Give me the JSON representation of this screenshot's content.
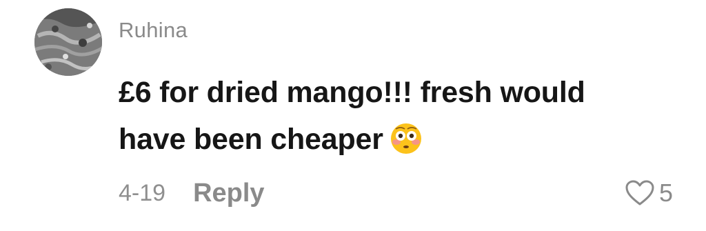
{
  "comment": {
    "username": "Ruhina",
    "text_line1": "£6 for dried mango!!! fresh would",
    "text_line2": "have been cheaper",
    "emoji": "flushed-face-emoji",
    "date": "4-19",
    "reply_label": "Reply",
    "like_count": "5"
  },
  "colors": {
    "username": "#8a8a8a",
    "body_text": "#161616",
    "meta_text": "#8f8f8f",
    "emoji_face": "#fcc21b"
  }
}
